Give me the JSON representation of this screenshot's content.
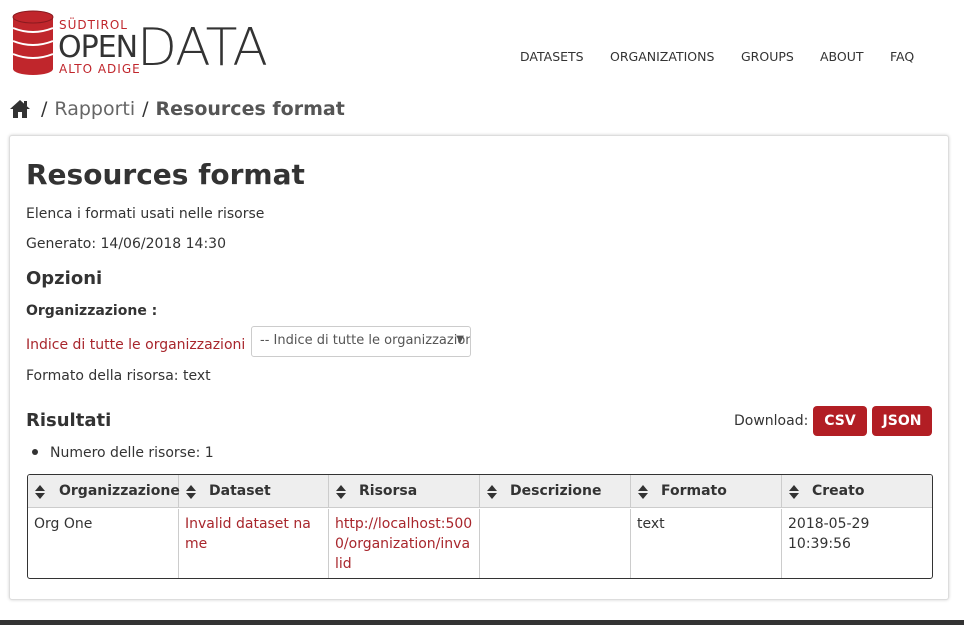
{
  "header": {
    "logo": {
      "line1": "SÜDTIROL",
      "line2": "OPEN",
      "line3": "ALTO ADIGE",
      "big": "DATA",
      "accent_color": "#c0262c"
    },
    "nav": [
      {
        "label": "DATASETS"
      },
      {
        "label": "ORGANIZATIONS"
      },
      {
        "label": "GROUPS"
      },
      {
        "label": "ABOUT"
      },
      {
        "label": "FAQ"
      }
    ]
  },
  "breadcrumb": {
    "home_icon": "home-icon",
    "sep": "/",
    "parent": "Rapporti",
    "current": "Resources format"
  },
  "report": {
    "title": "Resources format",
    "description": "Elenca i formati usati nelle risorse",
    "generated": "Generato: 14/06/2018 14:30",
    "options_heading": "Opzioni",
    "org_label": "Organizzazione :",
    "org_link": "Indice di tutte le organizzazioni",
    "org_select_value": "-- Indice di tutte le organizzazioni --",
    "format_line": "Formato della risorsa: text",
    "results_heading": "Risultati",
    "download_label": "Download:",
    "csv_label": "CSV",
    "json_label": "JSON",
    "count": "Numero delle risorse: 1",
    "button_color": "#b21e24",
    "link_color": "#a8262c"
  },
  "table": {
    "columns": [
      "Organizzazione",
      "Dataset",
      "Risorsa",
      "Descrizione",
      "Formato",
      "Creato"
    ],
    "rows": [
      {
        "organizzazione": "Org One",
        "dataset": "Invalid dataset name",
        "risorsa": "http://localhost:5000/organization/invalid",
        "descrizione": "",
        "formato": "text",
        "creato": "2018-05-29 10:39:56"
      }
    ]
  }
}
